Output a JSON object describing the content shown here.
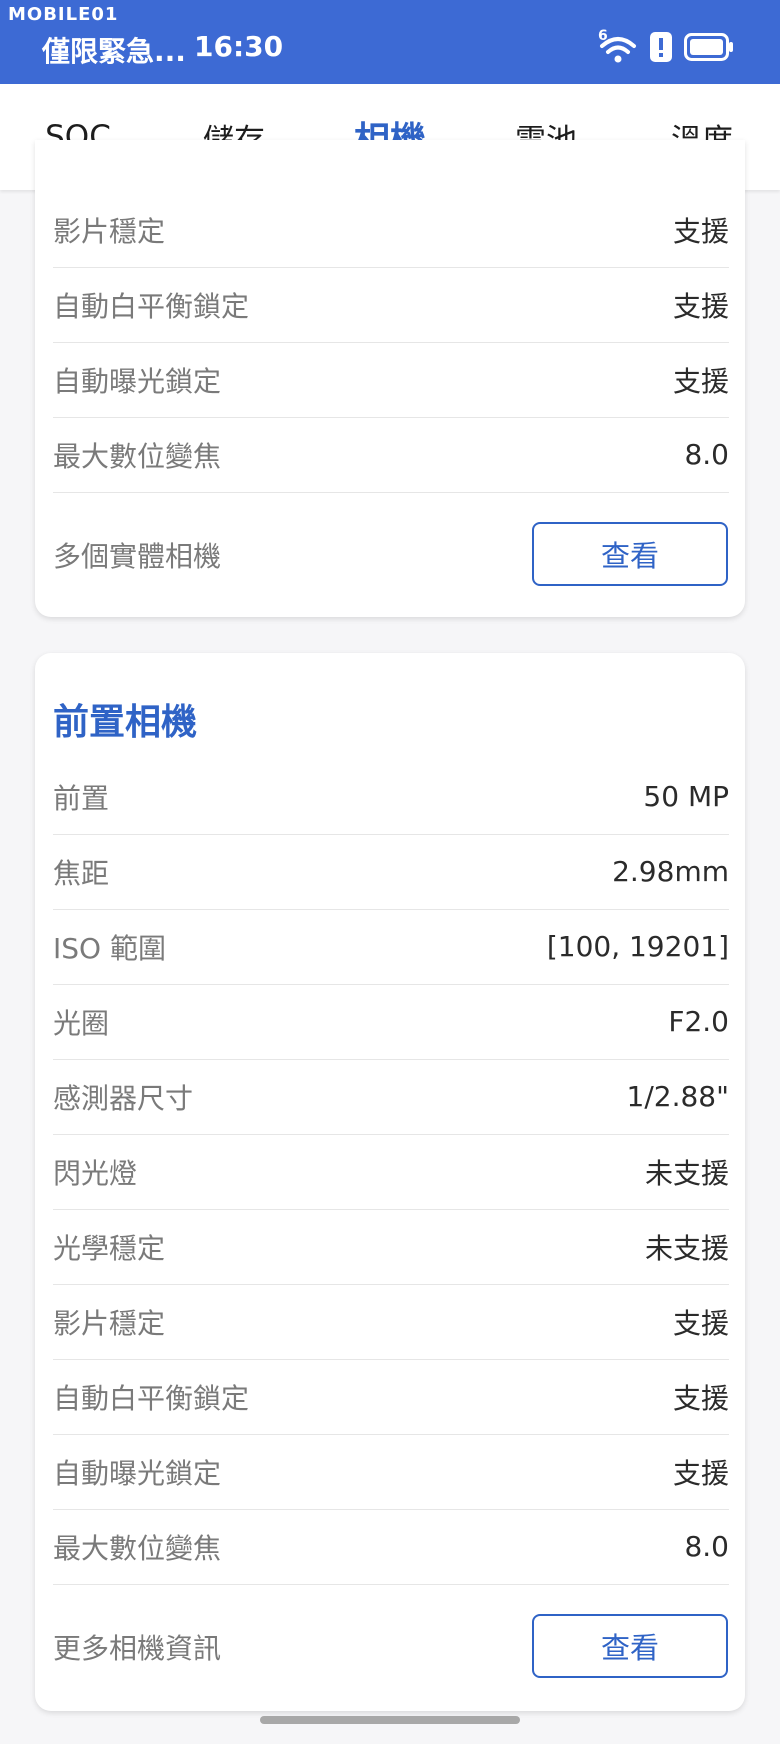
{
  "status_bar": {
    "watermark": "MOBILE01",
    "carrier": "僅限緊急...",
    "time": "16:30",
    "wifi_badge": "6",
    "icons": [
      "wifi-icon",
      "alert-icon",
      "battery-icon"
    ]
  },
  "tabs": [
    {
      "label": "SOC",
      "active": false
    },
    {
      "label": "儲存",
      "active": false
    },
    {
      "label": "相機",
      "active": true
    },
    {
      "label": "電池",
      "active": false
    },
    {
      "label": "溫度",
      "active": false
    }
  ],
  "rear_camera_tail": {
    "rows": [
      {
        "key": "影片穩定",
        "value": "支援"
      },
      {
        "key": "自動白平衡鎖定",
        "value": "支援"
      },
      {
        "key": "自動曝光鎖定",
        "value": "支援"
      },
      {
        "key": "最大數位變焦",
        "value": "8.0"
      }
    ],
    "action": {
      "label": "多個實體相機",
      "button": "查看"
    }
  },
  "front_camera": {
    "title": "前置相機",
    "rows": [
      {
        "key": "前置",
        "value": "50 MP"
      },
      {
        "key": "焦距",
        "value": "2.98mm"
      },
      {
        "key": "ISO 範圍",
        "value": "[100, 19201]"
      },
      {
        "key": "光圈",
        "value": "F2.0"
      },
      {
        "key": "感測器尺寸",
        "value": "1/2.88\""
      },
      {
        "key": "閃光燈",
        "value": "未支援"
      },
      {
        "key": "光學穩定",
        "value": "未支援"
      },
      {
        "key": "影片穩定",
        "value": "支援"
      },
      {
        "key": "自動白平衡鎖定",
        "value": "支援"
      },
      {
        "key": "自動曝光鎖定",
        "value": "支援"
      },
      {
        "key": "最大數位變焦",
        "value": "8.0"
      }
    ],
    "action": {
      "label": "更多相機資訊",
      "button": "查看"
    }
  },
  "colors": {
    "accent": "#2f63c6",
    "status_bar": "#3d6ad4"
  }
}
